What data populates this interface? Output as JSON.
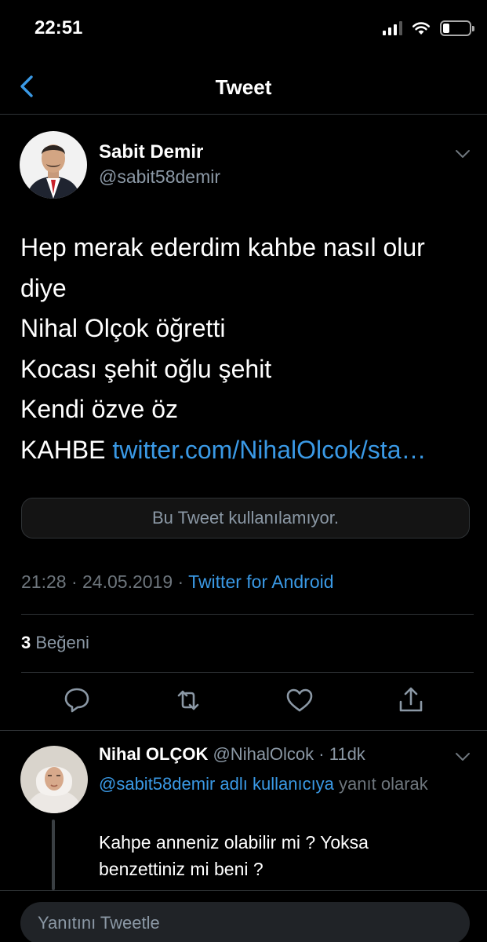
{
  "status_bar": {
    "time": "22:51"
  },
  "nav": {
    "title": "Tweet"
  },
  "tweet": {
    "author_name": "Sabit Demir",
    "author_handle": "@sabit58demir",
    "lines": [
      "Hep merak ederdim kahbe nasıl olur",
      "diye",
      "Nihal Olçok öğretti",
      "Kocası şehit oğlu şehit",
      "Kendi özve öz"
    ],
    "last_line_prefix": "KAHBE ",
    "link_text": "twitter.com/NihalOlcok/sta…",
    "quoted_unavailable": "Bu Tweet kullanılamıyor.",
    "time": "21:28",
    "date": "24.05.2019",
    "meta_sep": " · ",
    "source": "Twitter for Android",
    "like_count": "3",
    "like_label": " Beğeni"
  },
  "reply": {
    "author_name": "Nihal OLÇOK",
    "author_handle": "@NihalOlcok",
    "age": "· 11dk",
    "reply_to_mention": "@sabit58demir adlı kullanıcıya",
    "reply_to_suffix": " yanıt olarak",
    "text": "Kahpe anneniz olabilir mi ? Yoksa benzettiniz mi beni ?"
  },
  "compose": {
    "placeholder": "Yanıtını Tweetle"
  },
  "icons": {
    "back": "chevron-left-icon",
    "more": "chevron-down-icon",
    "reply": "reply-bubble-icon",
    "retweet": "retweet-icon",
    "like": "heart-icon",
    "share": "share-icon"
  },
  "colors": {
    "background": "#000000",
    "accent": "#3a99e5",
    "muted": "#8b98a5",
    "border": "#2f3336"
  }
}
